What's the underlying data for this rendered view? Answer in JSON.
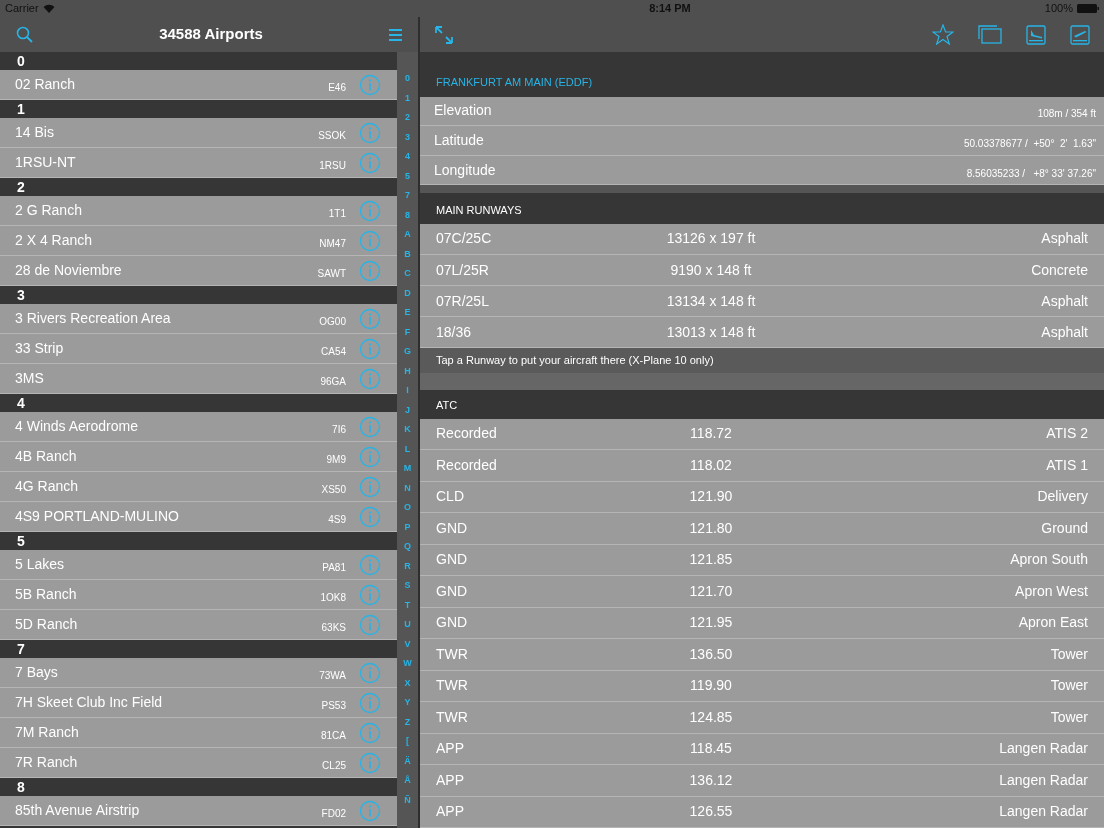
{
  "status_bar": {
    "carrier": "Carrier",
    "time": "8:14 PM",
    "battery": "100%"
  },
  "list": {
    "title": "34588 Airports",
    "sections": [
      {
        "header": "0",
        "rows": [
          {
            "name": "02 Ranch",
            "code": "E46"
          }
        ]
      },
      {
        "header": "1",
        "rows": [
          {
            "name": "14 Bis",
            "code": "SSOK"
          },
          {
            "name": "1RSU-NT",
            "code": "1RSU"
          }
        ]
      },
      {
        "header": "2",
        "rows": [
          {
            "name": "2 G Ranch",
            "code": "1T1"
          },
          {
            "name": "2 X 4 Ranch",
            "code": "NM47"
          },
          {
            "name": "28 de Noviembre",
            "code": "SAWT"
          }
        ]
      },
      {
        "header": "3",
        "rows": [
          {
            "name": "3 Rivers Recreation Area",
            "code": "OG00"
          },
          {
            "name": "33 Strip",
            "code": "CA54"
          },
          {
            "name": "3MS",
            "code": "96GA"
          }
        ]
      },
      {
        "header": "4",
        "rows": [
          {
            "name": "4 Winds Aerodrome",
            "code": "7I6"
          },
          {
            "name": "4B Ranch",
            "code": "9M9"
          },
          {
            "name": "4G Ranch",
            "code": "XS50"
          },
          {
            "name": "4S9 PORTLAND-MULINO",
            "code": "4S9"
          }
        ]
      },
      {
        "header": "5",
        "rows": [
          {
            "name": "5 Lakes",
            "code": "PA81"
          },
          {
            "name": "5B Ranch",
            "code": "1OK8"
          },
          {
            "name": "5D Ranch",
            "code": "63KS"
          }
        ]
      },
      {
        "header": "7",
        "rows": [
          {
            "name": "7 Bays",
            "code": "73WA"
          },
          {
            "name": "7H Skeet Club Inc Field",
            "code": "PS53"
          },
          {
            "name": "7M Ranch",
            "code": "81CA"
          },
          {
            "name": "7R Ranch",
            "code": "CL25"
          }
        ]
      },
      {
        "header": "8",
        "rows": [
          {
            "name": "85th Avenue Airstrip",
            "code": "FD02"
          }
        ]
      }
    ],
    "index": [
      "0",
      "1",
      "2",
      "3",
      "4",
      "5",
      "7",
      "8",
      "A",
      "B",
      "C",
      "D",
      "E",
      "F",
      "G",
      "H",
      "I",
      "J",
      "K",
      "L",
      "M",
      "N",
      "O",
      "P",
      "Q",
      "R",
      "S",
      "T",
      "U",
      "V",
      "W",
      "X",
      "Y",
      "Z",
      "[",
      "Ä",
      "Å",
      "Ñ"
    ]
  },
  "detail": {
    "title": "FRANKFURT AM MAIN (EDDF)",
    "info": [
      {
        "label": "Elevation",
        "value": "108m / 354 ft"
      },
      {
        "label": "Latitude",
        "value": "50.03378677 /  +50°  2'  1.63\""
      },
      {
        "label": "Longitude",
        "value": "8.56035233 /   +8° 33' 37.26\""
      }
    ],
    "runways": {
      "header": "MAIN RUNWAYS",
      "rows": [
        {
          "name": "07C/25C",
          "size": "13126 x 197 ft",
          "surface": "Asphalt"
        },
        {
          "name": "07L/25R",
          "size": "9190 x 148 ft",
          "surface": "Concrete"
        },
        {
          "name": "07R/25L",
          "size": "13134 x 148 ft",
          "surface": "Asphalt"
        },
        {
          "name": "18/36",
          "size": "13013 x 148 ft",
          "surface": "Asphalt"
        }
      ],
      "footer": "Tap a Runway to put your aircraft there (X-Plane 10 only)"
    },
    "atc": {
      "header": "ATC",
      "rows": [
        {
          "type": "Recorded",
          "frequency": "118.72",
          "name": "ATIS 2"
        },
        {
          "type": "Recorded",
          "frequency": "118.02",
          "name": "ATIS 1"
        },
        {
          "type": "CLD",
          "frequency": "121.90",
          "name": "Delivery"
        },
        {
          "type": "GND",
          "frequency": "121.80",
          "name": "Ground"
        },
        {
          "type": "GND",
          "frequency": "121.85",
          "name": "Apron South"
        },
        {
          "type": "GND",
          "frequency": "121.70",
          "name": "Apron West"
        },
        {
          "type": "GND",
          "frequency": "121.95",
          "name": "Apron East"
        },
        {
          "type": "TWR",
          "frequency": "136.50",
          "name": "Tower"
        },
        {
          "type": "TWR",
          "frequency": "119.90",
          "name": "Tower"
        },
        {
          "type": "TWR",
          "frequency": "124.85",
          "name": "Tower"
        },
        {
          "type": "APP",
          "frequency": "118.45",
          "name": "Langen Radar"
        },
        {
          "type": "APP",
          "frequency": "136.12",
          "name": "Langen Radar"
        },
        {
          "type": "APP",
          "frequency": "126.55",
          "name": "Langen Radar"
        }
      ]
    }
  }
}
